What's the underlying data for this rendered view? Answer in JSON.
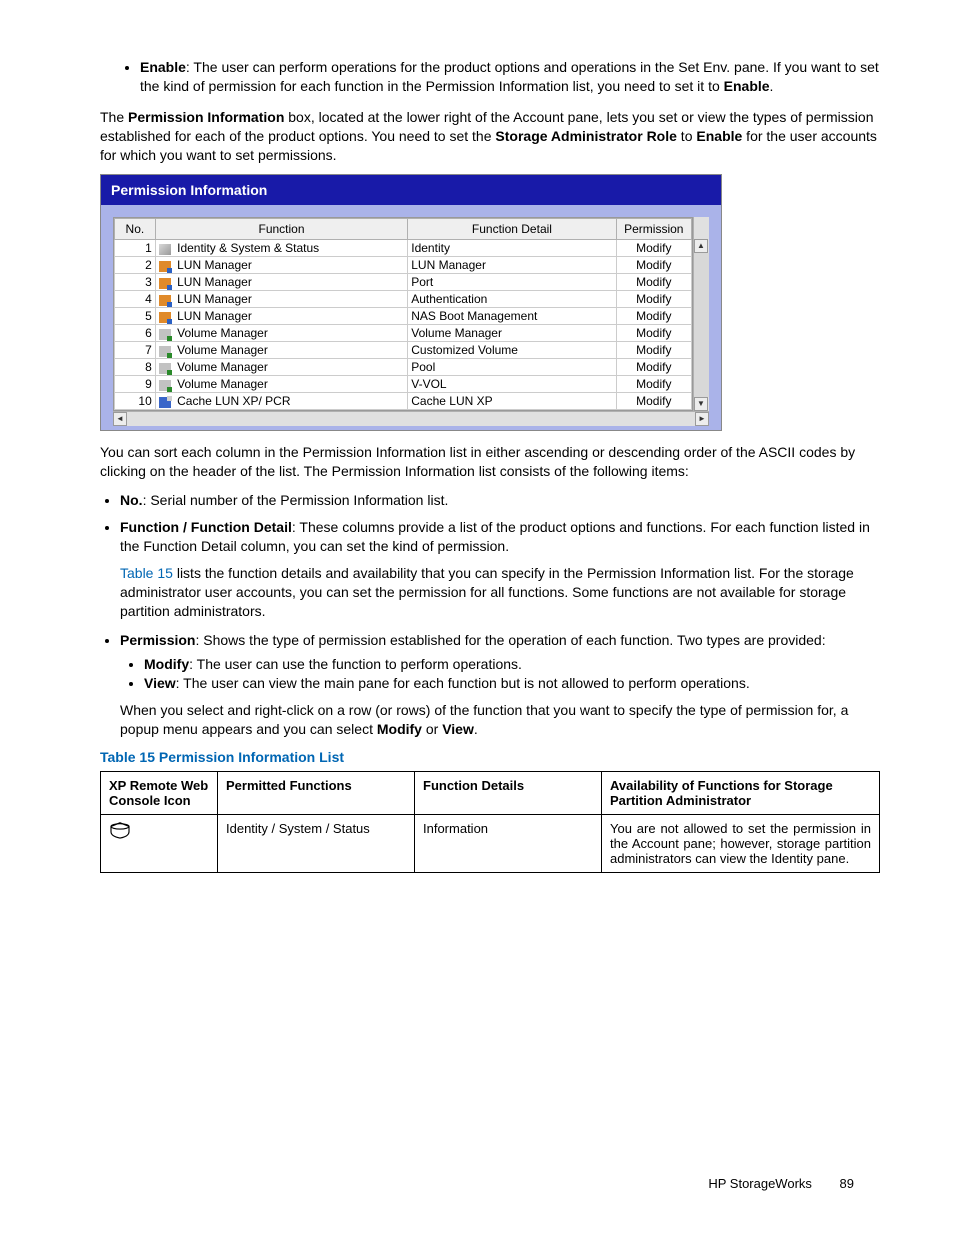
{
  "top_bullet": {
    "bold": "Enable",
    "text": ": The user can perform operations for the product options and operations in the Set Env. pane. If you want to set the kind of permission for each function in the Permission Information list, you need to set it to ",
    "bold2": "Enable",
    "tail": "."
  },
  "para1": {
    "pre": "The ",
    "b1": "Permission Information",
    "mid": " box, located at the lower right of the Account pane, lets you set or view the types of permission established for each of the product options. You need to set the ",
    "b2": "Storage Administrator Role",
    "mid2": " to ",
    "b3": "Enable",
    "tail": " for the user accounts for which you want to set permissions."
  },
  "perm_box": {
    "title": "Permission Information",
    "headers": {
      "no": "No.",
      "function": "Function",
      "detail": "Function Detail",
      "permission": "Permission"
    },
    "rows": [
      {
        "no": "1",
        "icon": "id",
        "func": "Identity & System & Status",
        "detail": "Identity",
        "perm": "Modify"
      },
      {
        "no": "2",
        "icon": "lun",
        "func": "LUN Manager",
        "detail": "LUN Manager",
        "perm": "Modify"
      },
      {
        "no": "3",
        "icon": "lun",
        "func": "LUN Manager",
        "detail": "Port",
        "perm": "Modify"
      },
      {
        "no": "4",
        "icon": "lun",
        "func": "LUN Manager",
        "detail": "Authentication",
        "perm": "Modify"
      },
      {
        "no": "5",
        "icon": "lun",
        "func": "LUN Manager",
        "detail": "NAS Boot Management",
        "perm": "Modify"
      },
      {
        "no": "6",
        "icon": "vol",
        "func": "Volume Manager",
        "detail": "Volume Manager",
        "perm": "Modify"
      },
      {
        "no": "7",
        "icon": "vol",
        "func": "Volume Manager",
        "detail": "Customized Volume",
        "perm": "Modify"
      },
      {
        "no": "8",
        "icon": "vol",
        "func": "Volume Manager",
        "detail": "Pool",
        "perm": "Modify"
      },
      {
        "no": "9",
        "icon": "vol",
        "func": "Volume Manager",
        "detail": "V-VOL",
        "perm": "Modify"
      },
      {
        "no": "10",
        "icon": "cache",
        "func": "Cache LUN XP/ PCR",
        "detail": "Cache LUN XP",
        "perm": "Modify"
      }
    ]
  },
  "para2": "You can sort each column in the Permission Information list in either ascending or descending order of the ASCII codes by clicking on the header of the list. The Permission Information list consists of the following items:",
  "items": {
    "no": {
      "bold": "No.",
      "text": ": Serial number of the Permission Information list."
    },
    "func": {
      "bold": "Function / Function Detail",
      "text": ": These columns provide a list of the product options and functions. For each function listed in the Function Detail column, you can set the kind of permission.",
      "sub_pre": "",
      "link": "Table 15",
      "sub_post": " lists the function details and availability that you can specify in the Permission Information list. For the storage administrator user accounts, you can set the permission for all functions. Some functions are not available for storage partition administrators."
    },
    "perm": {
      "bold": "Permission",
      "text": ": Shows the type of permission established for the operation of each function. Two types are provided:",
      "modify": {
        "bold": "Modify",
        "text": ": The user can use the function to perform operations."
      },
      "view": {
        "bold": "View",
        "text": ": The user can view the main pane for each function but is not allowed to perform operations."
      },
      "tail_pre": "When you select and right-click on a row (or rows) of the function that you want to specify the type of permission for, a popup menu appears and you can select ",
      "tail_b1": "Modify",
      "tail_mid": " or ",
      "tail_b2": "View",
      "tail_post": "."
    }
  },
  "table15": {
    "caption": "Table 15 Permission Information List",
    "headers": {
      "icon": "XP Remote Web Console Icon",
      "permitted": "Permitted Functions",
      "details": "Function Details",
      "availability": "Availability of Functions for Storage Partition Administrator"
    },
    "row1": {
      "permitted": "Identity / System / Status",
      "details": "Information",
      "availability": "You are not allowed to set the permission in the Account pane; however, storage partition administrators can view the Identity pane."
    }
  },
  "footer": {
    "brand": "HP StorageWorks",
    "page": "89"
  }
}
